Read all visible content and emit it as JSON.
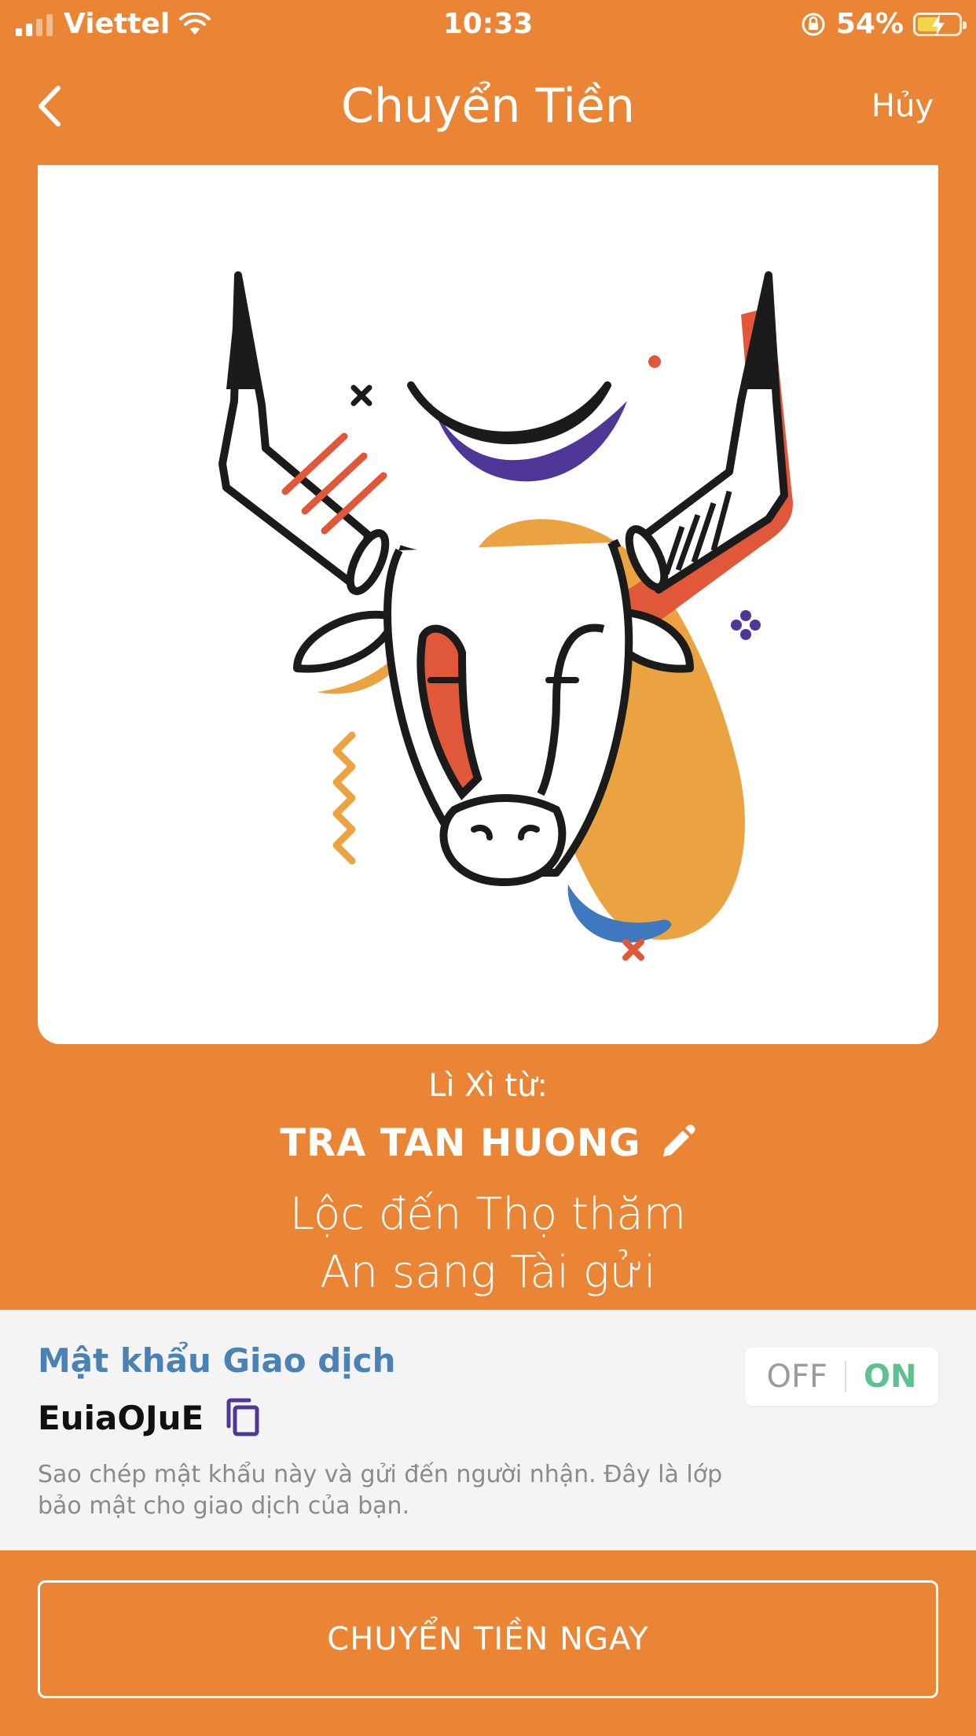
{
  "status_bar": {
    "carrier": "Viettel",
    "time": "10:33",
    "battery_percent": "54%",
    "battery_level": 0.54,
    "icons": [
      "signal-icon",
      "wifi-icon",
      "rotation-lock-icon",
      "battery-charging-icon"
    ]
  },
  "nav": {
    "title": "Chuyển Tiền",
    "cancel_label": "Hủy",
    "back_icon": "chevron-left-icon"
  },
  "card": {
    "illustration": "ox-head-illustration"
  },
  "greeting": {
    "from_label": "Lì Xì từ:",
    "sender_name": "TRA TAN HUONG",
    "edit_icon": "pencil-icon",
    "wish_line_1": "Lộc đến Thọ thăm",
    "wish_line_2": "An sang Tài gửi"
  },
  "password": {
    "title": "Mật khẩu Giao dịch",
    "value": "EuiaOJuE",
    "copy_icon": "copy-icon",
    "hint": "Sao chép mật khẩu này và gửi đến người nhận. Đây là lớp bảo mật cho giao dịch của bạn.",
    "toggle_off_label": "OFF",
    "toggle_on_label": "ON",
    "toggle_state": "ON"
  },
  "actions": {
    "transfer_label": "CHUYỂN TIỀN NGAY"
  },
  "colors": {
    "background": "#E98535",
    "accent_blue": "#4B82B4",
    "toggle_on": "#5CC28F",
    "panel": "#F4F4F5"
  }
}
